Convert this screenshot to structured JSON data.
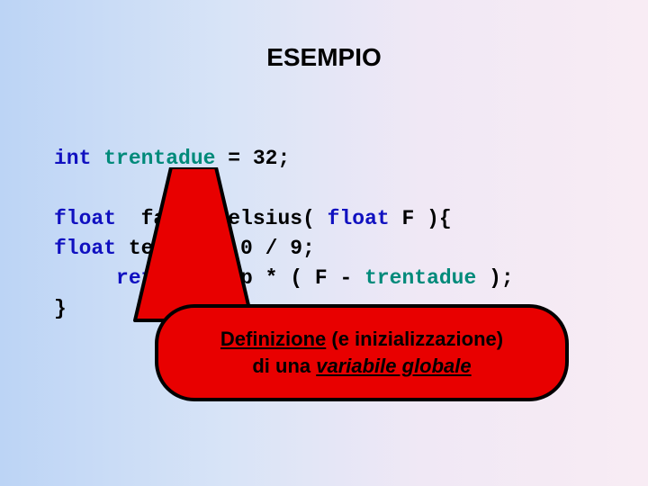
{
  "title": "ESEMPIO",
  "code": {
    "l0_kw": "int",
    "l0_id": " trentadue",
    "l0_rest": " = 32;",
    "l1_kw": "float ",
    "l1_rest": " fahrToCelsius( ",
    "l1_kw2": "float",
    "l1_rest2": " F ){",
    "l2_kw": "float ",
    "l2_rest": "temp = 5.0 / 9;",
    "l3_kw": "     return",
    "l3_rest": " temp * ( F - ",
    "l3_id": "trentadue",
    "l3_rest2": " );",
    "l4": "}"
  },
  "callout": {
    "line1_a": "Definizione",
    "line1_b": " (e inizializzazione)",
    "line2_a": "di una ",
    "line2_b": "variabile globale"
  }
}
